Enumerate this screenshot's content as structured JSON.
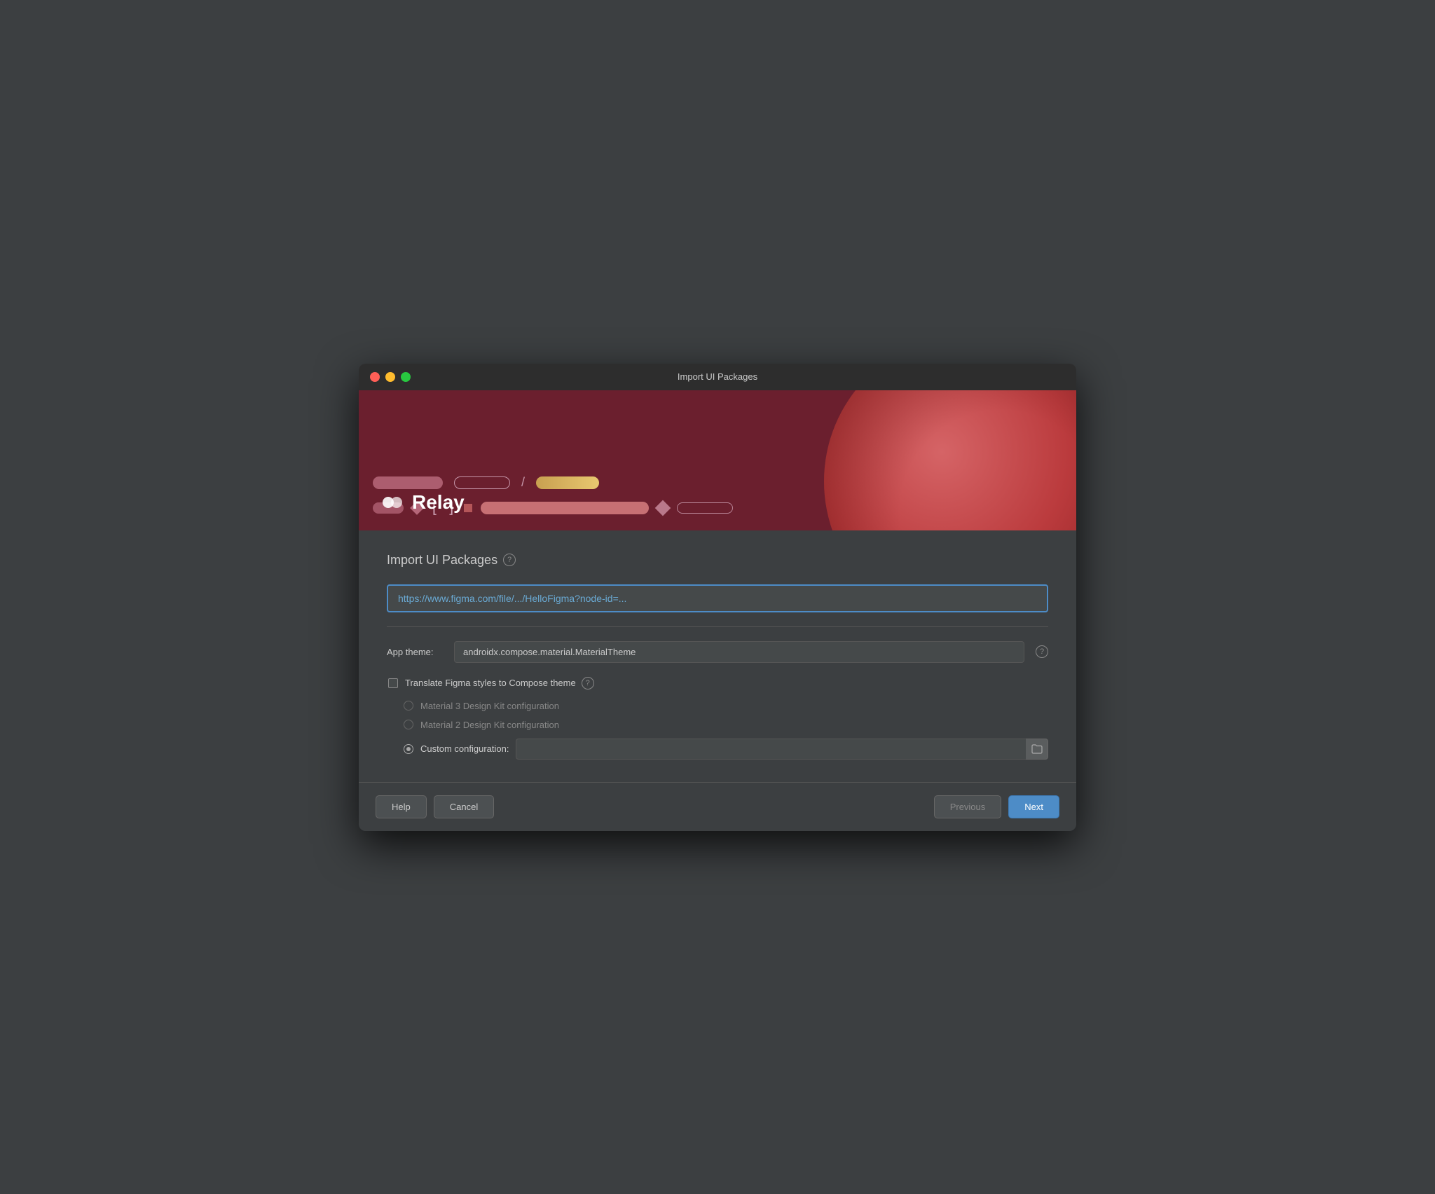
{
  "window": {
    "title": "Import UI Packages"
  },
  "hero": {
    "brand_name": "Relay",
    "brand_icon": "relay"
  },
  "form": {
    "section_title": "Import UI Packages",
    "url_input_value": "https://www.figma.com/file/.../HelloFigma?node-id=...",
    "url_input_placeholder": "https://www.figma.com/file/.../HelloFigma?node-id=...",
    "app_theme_label": "App theme:",
    "app_theme_value": "androidx.compose.material.MaterialTheme",
    "translate_checkbox_label": "Translate Figma styles to Compose theme",
    "radio_option1": "Material 3 Design Kit configuration",
    "radio_option2": "Material 2 Design Kit configuration",
    "radio_option3_label": "Custom configuration:",
    "custom_config_value": ""
  },
  "buttons": {
    "help_label": "Help",
    "cancel_label": "Cancel",
    "previous_label": "Previous",
    "next_label": "Next"
  },
  "help_circle": "?",
  "theme_help_circle": "?"
}
